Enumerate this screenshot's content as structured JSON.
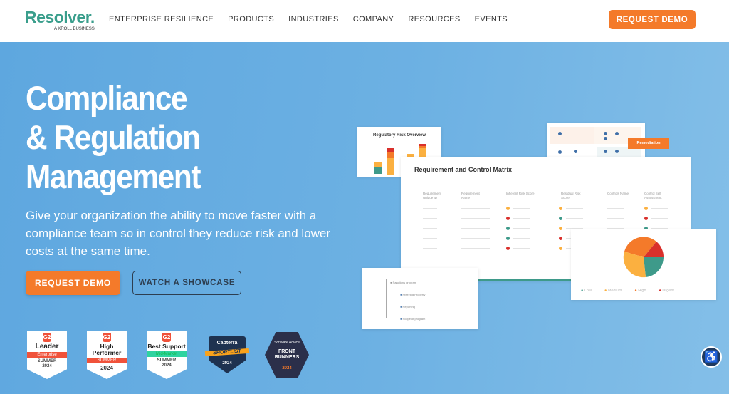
{
  "header": {
    "logo": "Resolver.",
    "logo_sub": "A KROLL BUSINESS",
    "nav": [
      "ENTERPRISE RESILIENCE",
      "PRODUCTS",
      "INDUSTRIES",
      "COMPANY",
      "RESOURCES",
      "EVENTS"
    ],
    "cta": "REQUEST DEMO"
  },
  "hero": {
    "title": [
      "Compliance",
      "& Regulation",
      "Management"
    ],
    "description": "Give your organization the ability to move faster with a compliance team so in control they reduce risk and lower costs at the same time.",
    "primary_button": "REQUEST DEMO",
    "secondary_button": "WATCH A SHOWCASE"
  },
  "illustration": {
    "risk_card_title": "Regulatory Risk Overview",
    "matrix_title": "Requirement and Control Matrix",
    "remediation_tag": "Remediation",
    "matrix_headers": [
      "Requirement Unique ID",
      "Requirement Name",
      "Inherent Risk Score",
      "Residual Risk Score",
      "Controls Name",
      "Control Self Assessment"
    ],
    "legend": [
      "Low",
      "Medium",
      "High",
      "Urgent"
    ],
    "tree_items": [
      "Sanctions program",
      "Freezing Property",
      "Reporting",
      "Scope of program"
    ]
  },
  "badges": [
    {
      "brand": "G2",
      "title": "Leader",
      "ribbon": "Enterprise",
      "season": "SUMMER",
      "year": "2024",
      "ribbon_color": "#f0523a"
    },
    {
      "brand": "G2",
      "title": "High Performer",
      "ribbon": "SUMMER",
      "season": "",
      "year": "2024",
      "ribbon_color": "#f0523a"
    },
    {
      "brand": "G2",
      "title": "Best Support",
      "ribbon": "Mid-Market",
      "season": "SUMMER",
      "year": "2024",
      "ribbon_color": "#2fd3a0"
    },
    {
      "brand": "Capterra",
      "title": "SHORTLIST",
      "year": "2024"
    },
    {
      "brand": "Software Advice",
      "title": "FRONT RUNNERS",
      "year": "2024"
    }
  ],
  "colors": {
    "brand_teal": "#3a9e8c",
    "accent_orange": "#f47a2a",
    "low": "#3e9a8a",
    "medium": "#fbb040",
    "high": "#f47a2a",
    "urgent": "#d9302c"
  },
  "icons": {
    "accessibility": "accessibility-icon"
  }
}
